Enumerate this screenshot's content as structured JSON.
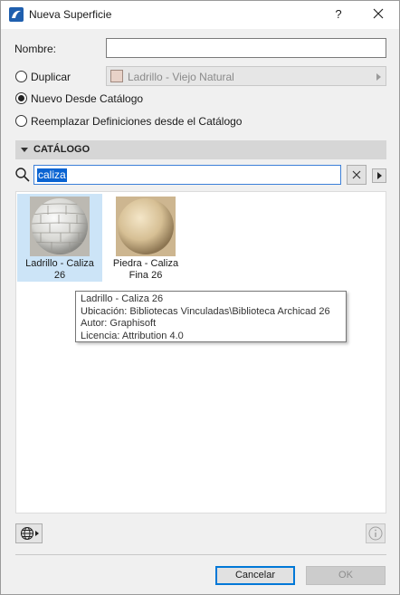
{
  "window": {
    "title": "Nueva Superficie",
    "help_label": "?"
  },
  "form": {
    "name_label": "Nombre:",
    "name_value": "",
    "duplicate_label": "Duplicar",
    "duplicate_value": "Ladrillo - Viejo Natural",
    "new_from_catalog_label": "Nuevo Desde Catálogo",
    "replace_label": "Reemplazar Definiciones desde el Catálogo",
    "selected_option": "new_from_catalog"
  },
  "catalog": {
    "header": "CATÁLOGO",
    "search_value": "caliza",
    "items": [
      {
        "name_line1": "Ladrillo - Caliza",
        "name_line2": "26",
        "selected": true
      },
      {
        "name_line1": "Piedra - Caliza",
        "name_line2": "Fina 26",
        "selected": false
      }
    ]
  },
  "tooltip": {
    "line1": "Ladrillo - Caliza 26",
    "line2": "Ubicación: Bibliotecas Vinculadas\\Biblioteca Archicad 26",
    "line3": "Autor: Graphisoft",
    "line4": "Licencia: Attribution 4.0"
  },
  "buttons": {
    "cancel": "Cancelar",
    "ok": "OK"
  },
  "colors": {
    "accent": "#0078d7",
    "selection": "#cce4f7"
  }
}
